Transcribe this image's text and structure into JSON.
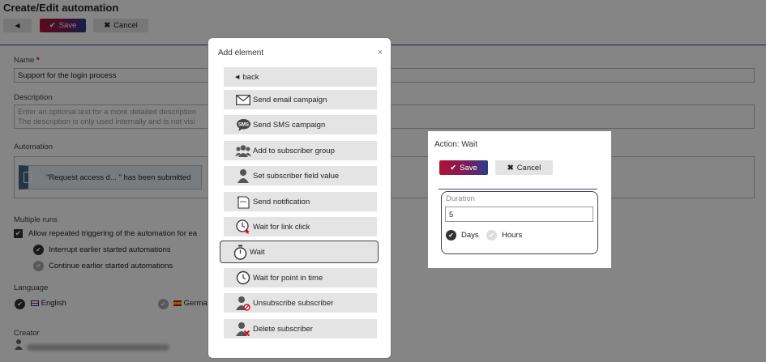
{
  "page": {
    "title": "Create/Edit automation",
    "save_label": "Save",
    "cancel_label": "Cancel"
  },
  "form": {
    "name_label": "Name",
    "name_required": "*",
    "name_value": "Support for the login process",
    "description_label": "Description",
    "description_placeholder_1": "Enter an optional text for a more detailed description",
    "description_placeholder_2": "The description is only used internally and is not visi",
    "automation_label": "Automation",
    "trigger_text": "\"Request access d... \" has been submitted",
    "multiple_runs_label": "Multiple runs",
    "allow_repeat_label": "Allow repeated triggering of the automation for ea",
    "interrupt_label": "Interrupt earlier started automations",
    "continue_label": "Continue earlier started automations",
    "language_label": "Language",
    "language_english": "English",
    "language_german": "Germa",
    "creator_label": "Creator"
  },
  "add_element_modal": {
    "title": "Add element",
    "close": "×",
    "back_label": "back",
    "items": [
      {
        "label": "Send email campaign",
        "icon": "envelope-icon"
      },
      {
        "label": "Send SMS campaign",
        "icon": "sms-icon"
      },
      {
        "label": "Add to subscriber group",
        "icon": "group-icon"
      },
      {
        "label": "Set subscriber field value",
        "icon": "person-icon"
      },
      {
        "label": "Send notification",
        "icon": "notification-icon"
      },
      {
        "label": "Wait for link click",
        "icon": "clock-link-icon"
      },
      {
        "label": "Wait",
        "icon": "stopwatch-icon"
      },
      {
        "label": "Wait for point in time",
        "icon": "clock-icon"
      },
      {
        "label": "Unsubscribe subscriber",
        "icon": "person-block-icon"
      },
      {
        "label": "Delete subscriber",
        "icon": "person-delete-icon"
      }
    ],
    "selected": "Wait"
  },
  "wait_panel": {
    "title": "Action: Wait",
    "save_label": "Save",
    "cancel_label": "Cancel",
    "duration_label": "Duration",
    "duration_value": "5",
    "unit_days": "Days",
    "unit_hours": "Hours",
    "selected_unit": "Days"
  },
  "colors": {
    "accent_red": "#b01237",
    "accent_blue": "#2c3a8c",
    "item_bg": "#e4e4e4"
  }
}
